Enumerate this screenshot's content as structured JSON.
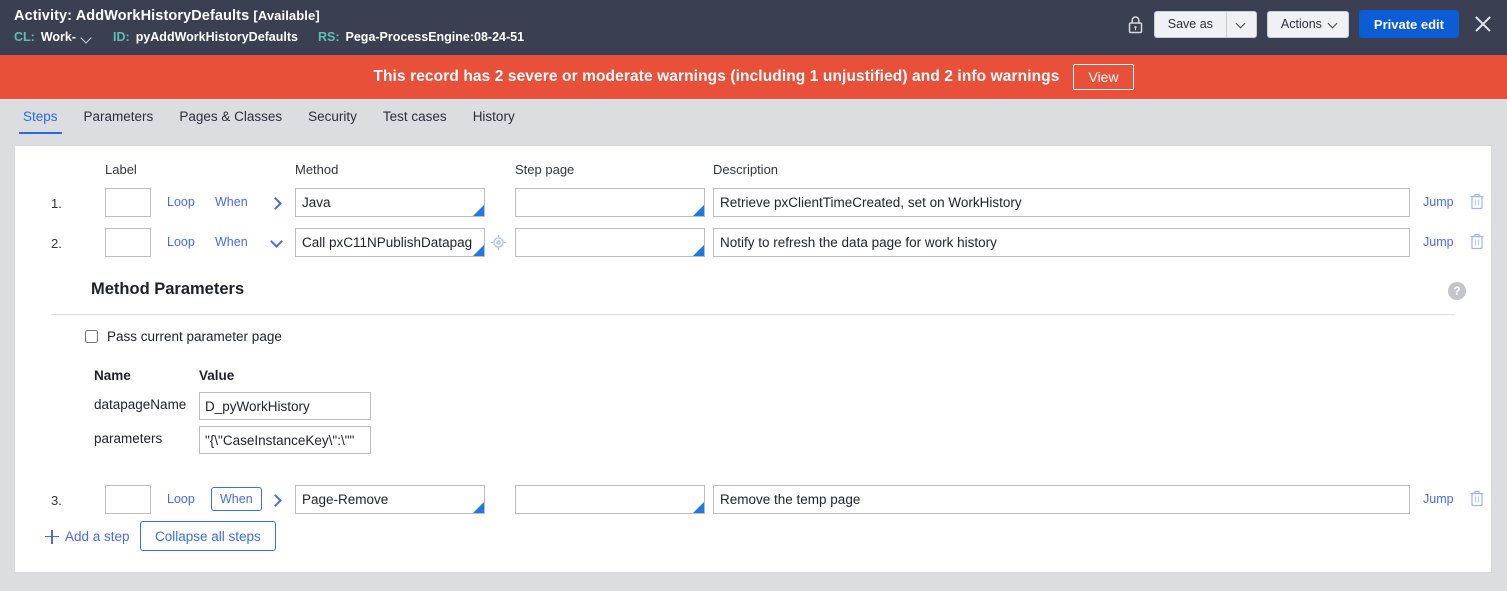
{
  "header": {
    "title_prefix": "Activity:",
    "title_name": "AddWorkHistoryDefaults",
    "availability": "[Available]",
    "meta": [
      {
        "key": "CL:",
        "value": "Work-",
        "caret": true
      },
      {
        "key": "ID:",
        "value": "pyAddWorkHistoryDefaults",
        "caret": false
      },
      {
        "key": "RS:",
        "value": "Pega-ProcessEngine:08-24-51",
        "caret": false
      }
    ],
    "lock_icon": "lock-icon",
    "save_as_label": "Save as",
    "save_as_caret_icon": "chevron-down-icon",
    "actions_label": "Actions",
    "actions_caret_icon": "chevron-down-icon",
    "private_edit_label": "Private edit",
    "close_icon": "close-icon",
    "bg_color": "#3b3f52",
    "accent_color": "#5dbfb0",
    "primary_color": "#0b5cd5"
  },
  "warning": {
    "message": "This record has 2 severe or moderate warnings (including 1 unjustified) and 2 info warnings",
    "view_label": "View",
    "color": "#e8503a"
  },
  "tabs": [
    {
      "label": "Steps",
      "active": true
    },
    {
      "label": "Parameters",
      "active": false
    },
    {
      "label": "Pages & Classes",
      "active": false
    },
    {
      "label": "Security",
      "active": false
    },
    {
      "label": "Test cases",
      "active": false
    },
    {
      "label": "History",
      "active": false
    }
  ],
  "steps_table": {
    "columns": [
      "Label",
      "Method",
      "Step page",
      "Description"
    ],
    "rows": [
      {
        "num": "1.",
        "label": "",
        "loop_label": "Loop",
        "when_label": "When",
        "when_boxed": false,
        "chevron": "chevron-right-icon",
        "method": "Java",
        "step_page": "",
        "description": "Retrieve pxClientTimeCreated, set on WorkHistory",
        "has_target_icon": false,
        "jump_label": "Jump",
        "delete_icon": "trash-icon"
      },
      {
        "num": "2.",
        "label": "",
        "loop_label": "Loop",
        "when_label": "When",
        "when_boxed": false,
        "chevron": "chevron-down-icon",
        "method": "Call pxC11NPublishDatapag",
        "step_page": "",
        "description": "Notify to refresh the data page for work history",
        "has_target_icon": true,
        "jump_label": "Jump",
        "delete_icon": "trash-icon"
      },
      {
        "num": "3.",
        "label": "",
        "loop_label": "Loop",
        "when_label": "When",
        "when_boxed": true,
        "chevron": "chevron-right-icon",
        "method": "Page-Remove",
        "step_page": "",
        "description": "Remove the temp page",
        "has_target_icon": false,
        "jump_label": "Jump",
        "delete_icon": "trash-icon"
      }
    ]
  },
  "method_parameters": {
    "title": "Method Parameters",
    "help_icon": "help-icon",
    "pass_current_label": "Pass current parameter page",
    "pass_current_checked": false,
    "col_name": "Name",
    "col_value": "Value",
    "params": [
      {
        "name": "datapageName",
        "value": "D_pyWorkHistory"
      },
      {
        "name": "parameters",
        "value": "\"{\\\"CaseInstanceKey\\\":\\\"\""
      }
    ]
  },
  "footer": {
    "add_step_label": "Add a step",
    "add_step_icon": "plus-icon",
    "collapse_label": "Collapse all steps"
  }
}
